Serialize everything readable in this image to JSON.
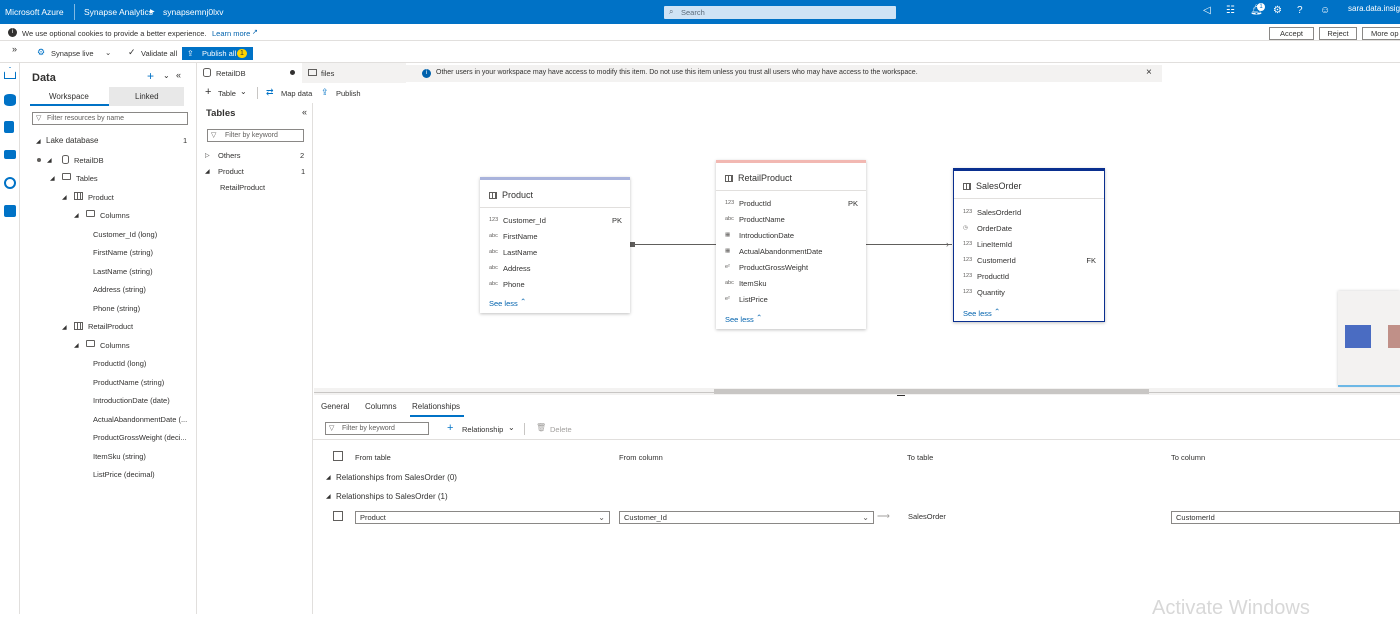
{
  "topbar": {
    "brand": "Microsoft Azure",
    "product": "Synapse Analytics",
    "workspace": "synapsemnj0lxv",
    "search_placeholder": "Search",
    "notification_count": "1",
    "user": "sara.data.insigh"
  },
  "cookie_bar": {
    "message": "We use optional cookies to provide a better experience.",
    "learn_more": "Learn more",
    "accept": "Accept",
    "reject": "Reject",
    "more_options": "More op"
  },
  "actionbar": {
    "synapse_live": "Synapse live",
    "validate_all": "Validate all",
    "publish_all": "Publish all",
    "publish_count": "1"
  },
  "data_panel": {
    "title": "Data",
    "tabs": [
      "Workspace",
      "Linked"
    ],
    "filter_placeholder": "Filter resources by name",
    "lake_database": "Lake database",
    "lake_count": "1",
    "db_name": "RetailDB",
    "tables_label": "Tables",
    "product_table": "Product",
    "columns_label": "Columns",
    "product_columns": [
      "Customer_Id (long)",
      "FirstName (string)",
      "LastName (string)",
      "Address (string)",
      "Phone (string)"
    ],
    "retail_table": "RetailProduct",
    "retail_columns": [
      "ProductId (long)",
      "ProductName (string)",
      "IntroductionDate (date)",
      "ActualAbandonmentDate (...",
      "ProductGrossWeight (deci...",
      "ItemSku (string)",
      "ListPrice (decimal)"
    ]
  },
  "tabs": {
    "tab1": "RetailDB",
    "tab2": "files",
    "info_message": "Other users in your workspace may have access to modify this item. Do not use this item unless you trust all users who may have access to the workspace."
  },
  "toolbar": {
    "table": "Table",
    "map_data": "Map data",
    "publish": "Publish"
  },
  "tables_panel": {
    "title": "Tables",
    "filter_placeholder": "Filter by keyword",
    "groups": [
      {
        "name": "Others",
        "count": "2"
      },
      {
        "name": "Product",
        "count": "1"
      }
    ],
    "child": "RetailProduct"
  },
  "entities": {
    "product": {
      "name": "Product",
      "columns": [
        {
          "type": "123",
          "name": "Customer_Id",
          "key": "PK"
        },
        {
          "type": "abc",
          "name": "FirstName",
          "key": ""
        },
        {
          "type": "abc",
          "name": "LastName",
          "key": ""
        },
        {
          "type": "abc",
          "name": "Address",
          "key": ""
        },
        {
          "type": "abc",
          "name": "Phone",
          "key": ""
        }
      ],
      "see_less": "See less"
    },
    "retailproduct": {
      "name": "RetailProduct",
      "columns": [
        {
          "type": "123",
          "name": "ProductId",
          "key": "PK"
        },
        {
          "type": "abc",
          "name": "ProductName",
          "key": ""
        },
        {
          "type": "cal",
          "name": "IntroductionDate",
          "key": ""
        },
        {
          "type": "cal",
          "name": "ActualAbandonmentDate",
          "key": ""
        },
        {
          "type": "e2",
          "name": "ProductGrossWeight",
          "key": ""
        },
        {
          "type": "abc",
          "name": "ItemSku",
          "key": ""
        },
        {
          "type": "e2",
          "name": "ListPrice",
          "key": ""
        }
      ],
      "see_less": "See less"
    },
    "salesorder": {
      "name": "SalesOrder",
      "columns": [
        {
          "type": "123",
          "name": "SalesOrderId",
          "key": ""
        },
        {
          "type": "clk",
          "name": "OrderDate",
          "key": ""
        },
        {
          "type": "123",
          "name": "LineItemId",
          "key": ""
        },
        {
          "type": "123",
          "name": "CustomerId",
          "key": "FK"
        },
        {
          "type": "123",
          "name": "ProductId",
          "key": ""
        },
        {
          "type": "123",
          "name": "Quantity",
          "key": ""
        }
      ],
      "see_less": "See less"
    }
  },
  "properties": {
    "tabs": [
      "General",
      "Columns",
      "Relationships"
    ],
    "filter_placeholder": "Filter by keyword",
    "relationship_btn": "Relationship",
    "delete_btn": "Delete",
    "headers": [
      "From table",
      "From column",
      "To table",
      "To column"
    ],
    "group_from": "Relationships from SalesOrder (0)",
    "group_to": "Relationships to SalesOrder (1)",
    "row": {
      "from_table": "Product",
      "from_column": "Customer_Id",
      "to_table": "SalesOrder",
      "to_column": "CustomerId"
    }
  },
  "watermark": "Activate Windows",
  "colors": {
    "azure_blue": "#0072c6",
    "product_accent": "#a9b3dc",
    "retail_accent": "#f2b8b2",
    "salesorder_accent": "#0a2f8f"
  }
}
